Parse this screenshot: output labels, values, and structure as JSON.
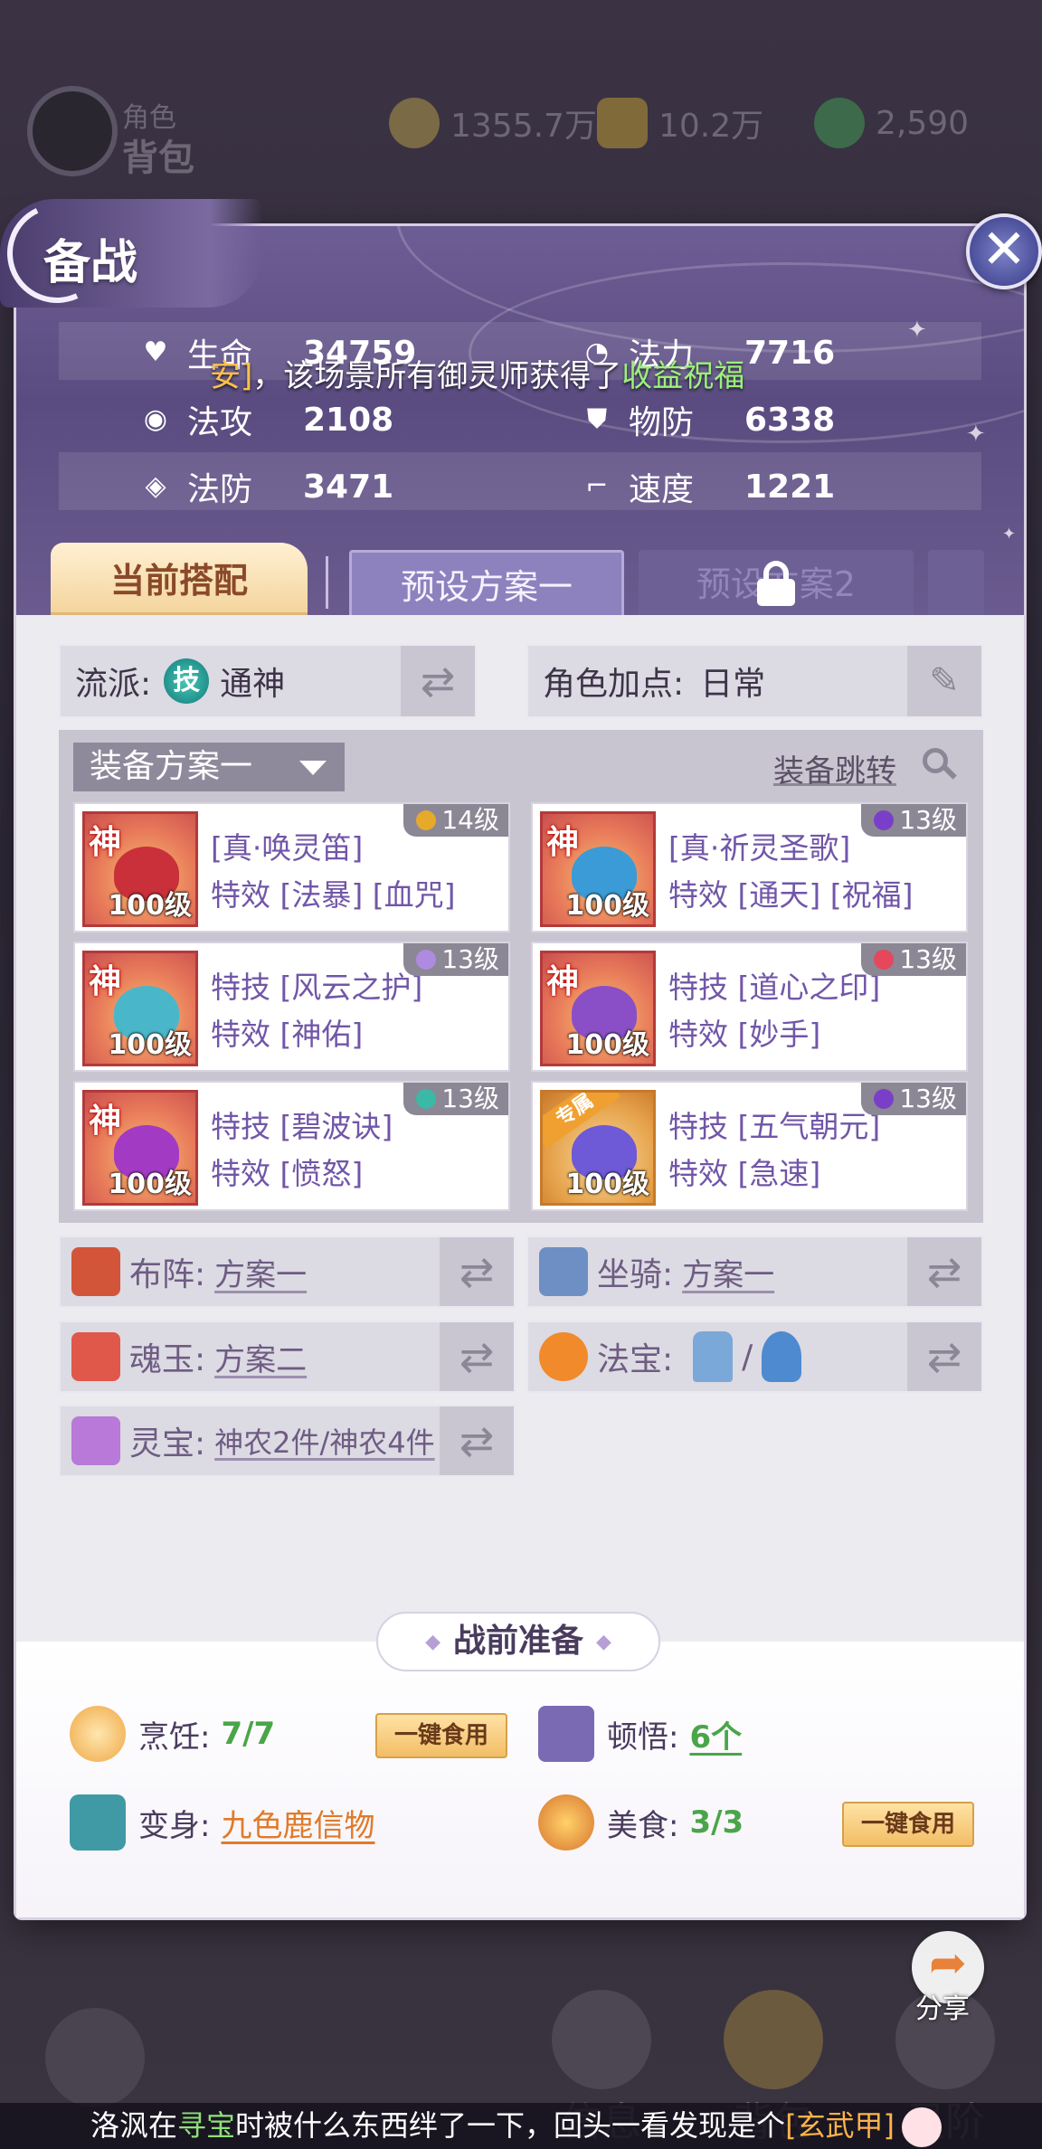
{
  "background": {
    "role_sub": "角色",
    "role_title": "背包",
    "currencies": [
      {
        "icon": "copper-coin-icon",
        "value": "1355.7万"
      },
      {
        "icon": "gold-ingot-icon",
        "value": "10.2万"
      },
      {
        "icon": "jade-icon",
        "value": "2,590"
      }
    ],
    "bottom_tabs": [
      "信息",
      "背包",
      "灵阶"
    ]
  },
  "panel": {
    "title": "备战",
    "close_symbol": "✕",
    "notice": {
      "prefix": "安]",
      "mid": "，该场景所有御灵师获得了",
      "highlight": "收益祝福"
    },
    "stats": [
      {
        "icon": "heart-icon",
        "label": "生命",
        "value": "34759"
      },
      {
        "icon": "mana-swirl-icon",
        "label": "法力",
        "value": "7716"
      },
      {
        "icon": "magic-attack-icon",
        "label": "法攻",
        "value": "2108"
      },
      {
        "icon": "shield-icon",
        "label": "物防",
        "value": "6338"
      },
      {
        "icon": "magic-defense-icon",
        "label": "法防",
        "value": "3471"
      },
      {
        "icon": "boot-icon",
        "label": "速度",
        "value": "1221"
      }
    ],
    "tabs": {
      "current": "当前搭配",
      "preset1": "预设方案一",
      "preset2": "预设方案2"
    },
    "faction": {
      "label": "流派:",
      "value": "通神",
      "icon_char": "技"
    },
    "points": {
      "label": "角色加点:",
      "value": "日常"
    },
    "equipment": {
      "scheme": "装备方案一",
      "jump": "装备跳转",
      "items": [
        {
          "badge": "神",
          "level": "100级",
          "gem_level": "14级",
          "gem_color": "#e6a92a",
          "line1": "[真·唤灵笛]",
          "line2": "特效 [法暴] [血咒]",
          "art": "#c9303a"
        },
        {
          "badge": "神",
          "level": "100级",
          "gem_level": "13级",
          "gem_color": "#7a3fc8",
          "line1": "[真·祈灵圣歌]",
          "line2": "特效 [通天] [祝福]",
          "art": "#3b9bd6"
        },
        {
          "badge": "神",
          "level": "100级",
          "gem_level": "13级",
          "gem_color": "#b08ae0",
          "line1": "特技 [风云之护]",
          "line2": "特效 [神佑]",
          "art": "#49b7c9"
        },
        {
          "badge": "神",
          "level": "100级",
          "gem_level": "13级",
          "gem_color": "#e5475c",
          "line1": "特技 [道心之印]",
          "line2": "特效 [妙手]",
          "art": "#8a4fc6"
        },
        {
          "badge": "神",
          "level": "100级",
          "gem_level": "13级",
          "gem_color": "#3bb9a6",
          "line1": "特技 [碧波诀]",
          "line2": "特效 [愤怒]",
          "art": "#a33ac3"
        },
        {
          "badge": "专属",
          "level": "100级",
          "gem_level": "13级",
          "gem_color": "#7a3fc8",
          "line1": "特技 [五气朝元]",
          "line2": "特效 [急速]",
          "art": "#6e59d6"
        }
      ]
    },
    "formation": {
      "label": "布阵:",
      "value": "方案一"
    },
    "mount": {
      "label": "坐骑:",
      "value": "方案一"
    },
    "soul_jade": {
      "label": "魂玉:",
      "value": "方案二"
    },
    "treasure": {
      "label": "法宝:",
      "separator": "/"
    },
    "spirit_treasure": {
      "label": "灵宝:",
      "value": "神农2件/神农4件"
    },
    "prep": {
      "title": "战前准备",
      "cooking": {
        "label": "烹饪:",
        "value": "7/7"
      },
      "enlighten": {
        "label": "顿悟:",
        "value": "6个"
      },
      "transform": {
        "label": "变身:",
        "value": "九色鹿信物"
      },
      "food": {
        "label": "美食:",
        "value": "3/3"
      },
      "eat_button": "一键食用"
    },
    "share": "分享"
  },
  "marquee": {
    "name": "洛沨",
    "pre": "在",
    "place": "寻宝",
    "mid": "时被什么东西绊了一下，回头一看发现是个",
    "item": "[玄武甲]"
  }
}
